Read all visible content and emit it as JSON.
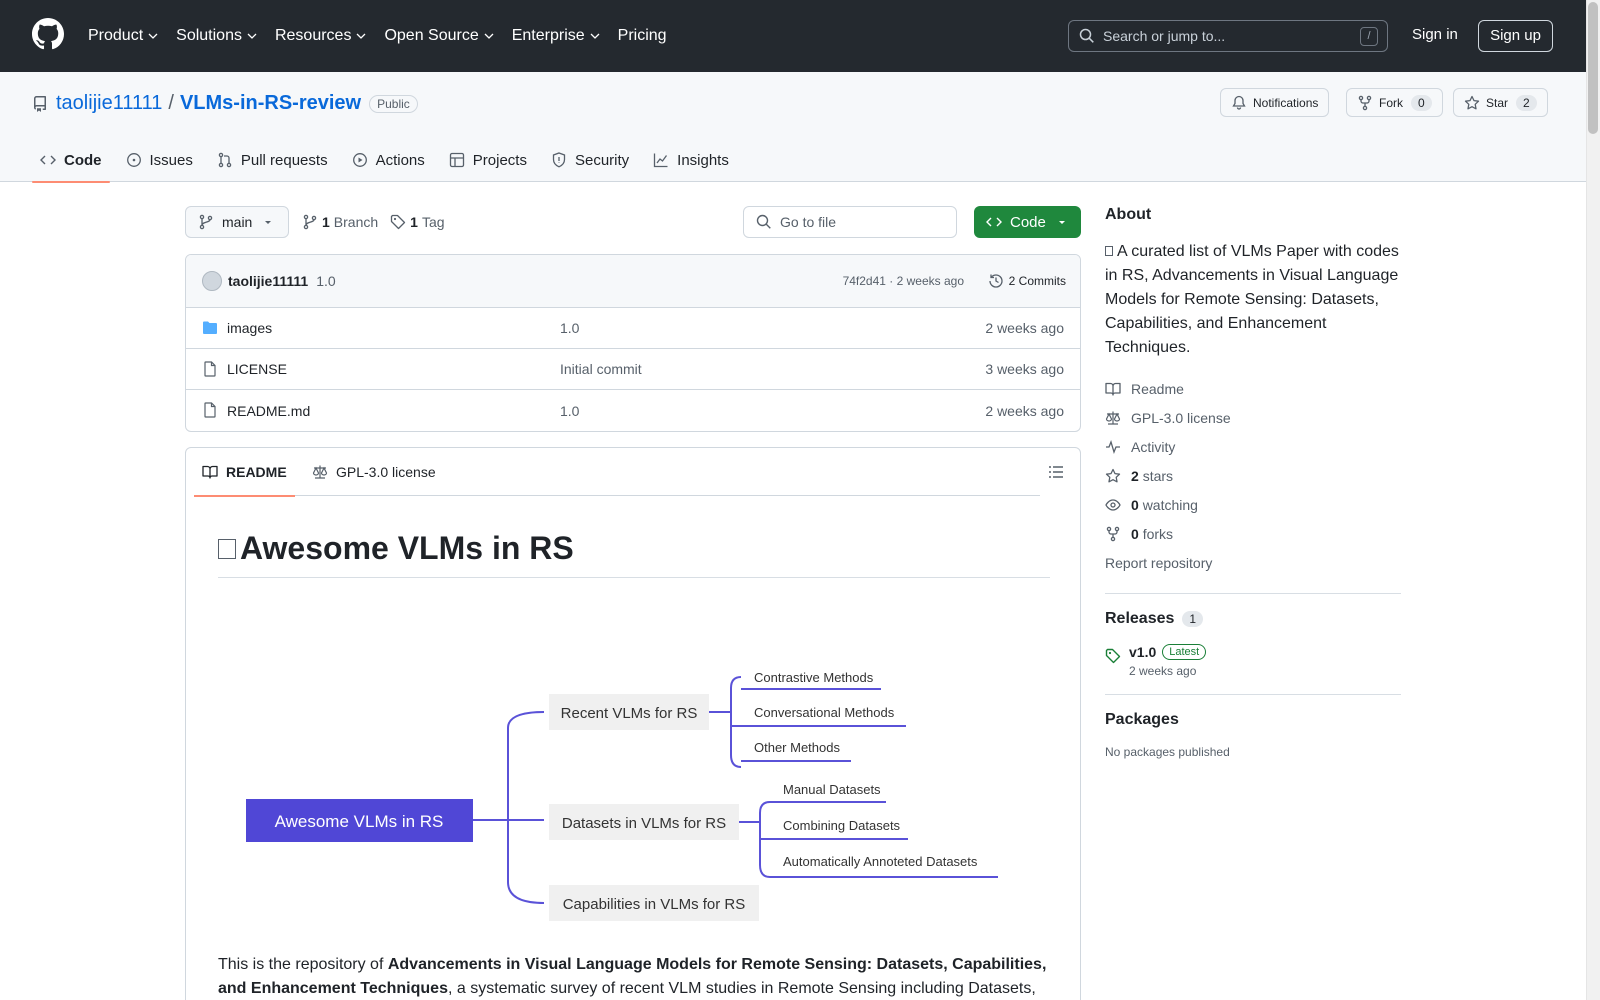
{
  "nav": {
    "items": [
      "Product",
      "Solutions",
      "Resources",
      "Open Source",
      "Enterprise",
      "Pricing"
    ],
    "search_placeholder": "Search or jump to...",
    "slash_key": "/",
    "signin": "Sign in",
    "signup": "Sign up"
  },
  "repo": {
    "owner": "taolijie11111",
    "separator": "/",
    "name": "VLMs-in-RS-review",
    "visibility": "Public",
    "notifications": "Notifications",
    "fork_label": "Fork",
    "fork_count": "0",
    "star_label": "Star",
    "star_count": "2"
  },
  "tabs": [
    "Code",
    "Issues",
    "Pull requests",
    "Actions",
    "Projects",
    "Security",
    "Insights"
  ],
  "toolbar": {
    "branch": "main",
    "branch_count": "1",
    "branch_label": "Branch",
    "tag_count": "1",
    "tag_label": "Tag",
    "goto_placeholder": "Go to file",
    "code_button": "Code"
  },
  "commit": {
    "author": "taolijie11111",
    "message": "1.0",
    "meta": "74f2d41 · 2 weeks ago",
    "commits": "2 Commits"
  },
  "files": [
    {
      "name": "images",
      "message": "1.0",
      "date": "2 weeks ago",
      "type": "folder"
    },
    {
      "name": "LICENSE",
      "message": "Initial commit",
      "date": "3 weeks ago",
      "type": "file"
    },
    {
      "name": "README.md",
      "message": "1.0",
      "date": "2 weeks ago",
      "type": "file"
    }
  ],
  "readme": {
    "tab_readme": "README",
    "tab_license": "GPL-3.0 license",
    "title": "Awesome VLMs in RS",
    "mindmap": {
      "root": "Awesome VLMs in RS",
      "branches": [
        "Recent VLMs for RS",
        "Datasets in VLMs for RS",
        "Capabilities in VLMs for RS"
      ],
      "recent_leaves": [
        "Contrastive Methods",
        "Conversational Methods",
        "Other Methods"
      ],
      "dataset_leaves": [
        "Manual Datasets",
        "Combining Datasets",
        "Automatically Annoteted Datasets"
      ]
    },
    "para_intro": "This is the repository of ",
    "para_bold": "Advancements in Visual Language Models for Remote Sensing: Datasets, Capabilities, and Enhancement Techniques",
    "para_rest": ", a systematic survey of recent VLM studies in Remote Sensing including Datasets,"
  },
  "about": {
    "heading": "About",
    "description": "A curated list of VLMs Paper with codes in RS, Advancements in Visual Language Models for Remote Sensing: Datasets, Capabilities, and Enhancement Techniques.",
    "readme": "Readme",
    "license": "GPL-3.0 license",
    "activity": "Activity",
    "stars_count": "2",
    "stars_label": "stars",
    "watching_count": "0",
    "watching_label": "watching",
    "forks_count": "0",
    "forks_label": "forks",
    "report": "Report repository"
  },
  "releases": {
    "heading": "Releases",
    "count": "1",
    "tag": "v1.0",
    "latest": "Latest",
    "date": "2 weeks ago"
  },
  "packages": {
    "heading": "Packages",
    "empty": "No packages published"
  },
  "colors": {
    "header_bg": "#24292f",
    "accent_blue": "#0969da",
    "green": "#1f883d",
    "tab_underline": "#fd8c73",
    "mindmap_root": "#5047d6"
  }
}
